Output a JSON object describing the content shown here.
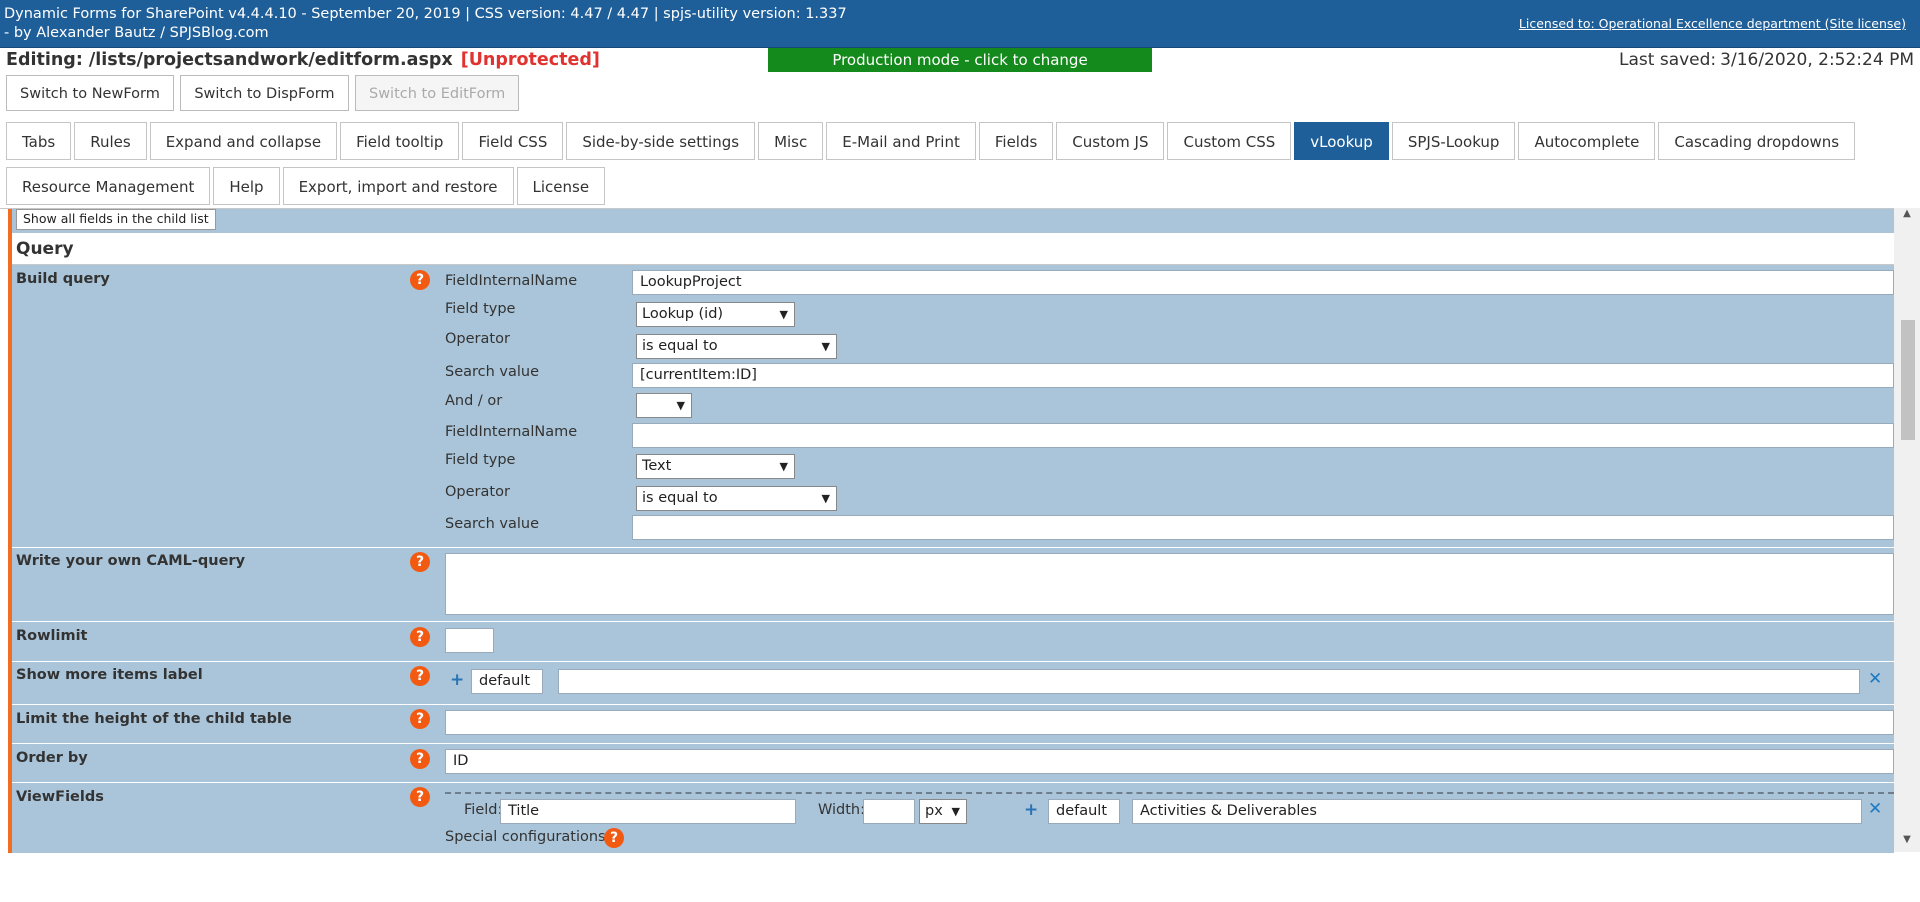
{
  "banner": {
    "line1": "Dynamic Forms for SharePoint v4.4.4.10 - September 20, 2019 | CSS version: 4.47 / 4.47 | spjs-utility version: 1.337",
    "line2": "- by Alexander Bautz / SPJSBlog.com",
    "license": "Licensed to: Operational Excellence department (Site license)"
  },
  "editing": {
    "path": "Editing: /lists/projectsandwork/editform.aspx",
    "status": "[Unprotected]",
    "mode": "Production mode - click to change",
    "last_saved_label": "Last saved:",
    "last_saved_value": "3/16/2020, 2:52:24 PM"
  },
  "switch_buttons": {
    "new": "Switch to NewForm",
    "disp": "Switch to DispForm",
    "edit": "Switch to EditForm"
  },
  "tabs": [
    "Tabs",
    "Rules",
    "Expand and collapse",
    "Field tooltip",
    "Field CSS",
    "Side-by-side settings",
    "Misc",
    "E-Mail and Print",
    "Fields",
    "Custom JS",
    "Custom CSS",
    "vLookup",
    "SPJS-Lookup",
    "Autocomplete",
    "Cascading dropdowns",
    "Resource Management",
    "Help",
    "Export, import and restore",
    "License"
  ],
  "active_tab": "vLookup",
  "main": {
    "show_all_fields": "Show all fields in the child list",
    "query_heading": "Query",
    "build_query": {
      "title": "Build query",
      "row1": {
        "field_internal_name_label": "FieldInternalName",
        "field_internal_name_value": "LookupProject",
        "field_type_label": "Field type",
        "field_type_value": "Lookup (id)",
        "operator_label": "Operator",
        "operator_value": "is equal to",
        "search_value_label": "Search value",
        "search_value_value": "[currentItem:ID]"
      },
      "and_or_label": "And / or",
      "and_or_value": "",
      "row2": {
        "field_internal_name_label": "FieldInternalName",
        "field_internal_name_value": "",
        "field_type_label": "Field type",
        "field_type_value": "Text",
        "operator_label": "Operator",
        "operator_value": "is equal to",
        "search_value_label": "Search value",
        "search_value_value": ""
      }
    },
    "caml_query": {
      "title": "Write your own CAML-query",
      "value": ""
    },
    "rowlimit": {
      "title": "Rowlimit",
      "value": ""
    },
    "show_more": {
      "title": "Show more items label",
      "lang": "default",
      "value": ""
    },
    "limit_height": {
      "title": "Limit the height of the child table",
      "value": ""
    },
    "order_by": {
      "title": "Order by",
      "value": "ID"
    },
    "viewfields": {
      "title": "ViewFields",
      "field_label": "Field:",
      "field_value": "Title",
      "width_label": "Width:",
      "width_value": "",
      "unit": "px",
      "lang": "default",
      "display_name": "Activities & Deliverables",
      "special_config_label": "Special configurations"
    }
  },
  "colors": {
    "banner": "#1f5f99",
    "production_mode": "#138a1b",
    "unprotected": "#e0322f",
    "panel": "#aac5d9",
    "accent_bar": "#f26c22",
    "help_icon": "#f25a12"
  }
}
